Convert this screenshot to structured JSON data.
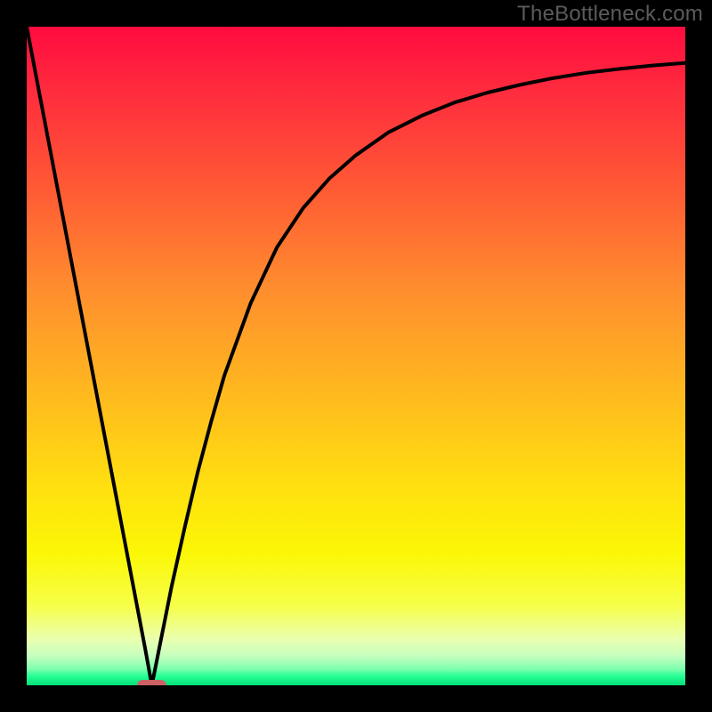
{
  "watermark": {
    "text": "TheBottleneck.com"
  },
  "colors": {
    "border": "#000000",
    "curve_stroke": "#000000",
    "marker_fill": "#cb6164",
    "gradient_stops": [
      "#ff0b3f",
      "#ff2c3e",
      "#ff5b34",
      "#ff8e2e",
      "#ffb71f",
      "#ffe010",
      "#fbf706",
      "#f6ff4a",
      "#eaffb0",
      "#c7ffbf",
      "#7fffae",
      "#2cff97",
      "#00e078"
    ]
  },
  "chart_data": {
    "type": "line",
    "title": "",
    "xlabel": "",
    "ylabel": "",
    "xlim": [
      0,
      100
    ],
    "ylim": [
      0,
      100
    ],
    "x": [
      0,
      2,
      4,
      6,
      8,
      10,
      12,
      14,
      16,
      18,
      19,
      20,
      22,
      24,
      26,
      28,
      30,
      34,
      38,
      42,
      46,
      50,
      55,
      60,
      65,
      70,
      75,
      80,
      85,
      90,
      95,
      100
    ],
    "values": [
      100,
      89.5,
      79,
      68.5,
      58,
      47.5,
      37,
      26.5,
      16,
      5.5,
      0,
      5,
      15,
      24,
      32.5,
      40,
      47,
      58,
      66.5,
      72.5,
      77,
      80.5,
      84,
      86.5,
      88.5,
      90,
      91.2,
      92.2,
      93,
      93.6,
      94.1,
      94.5
    ],
    "marker": {
      "x": 19,
      "y": 0,
      "width_pct": 4.5,
      "height_pct": 1.6
    },
    "grid": false,
    "legend": false
  }
}
